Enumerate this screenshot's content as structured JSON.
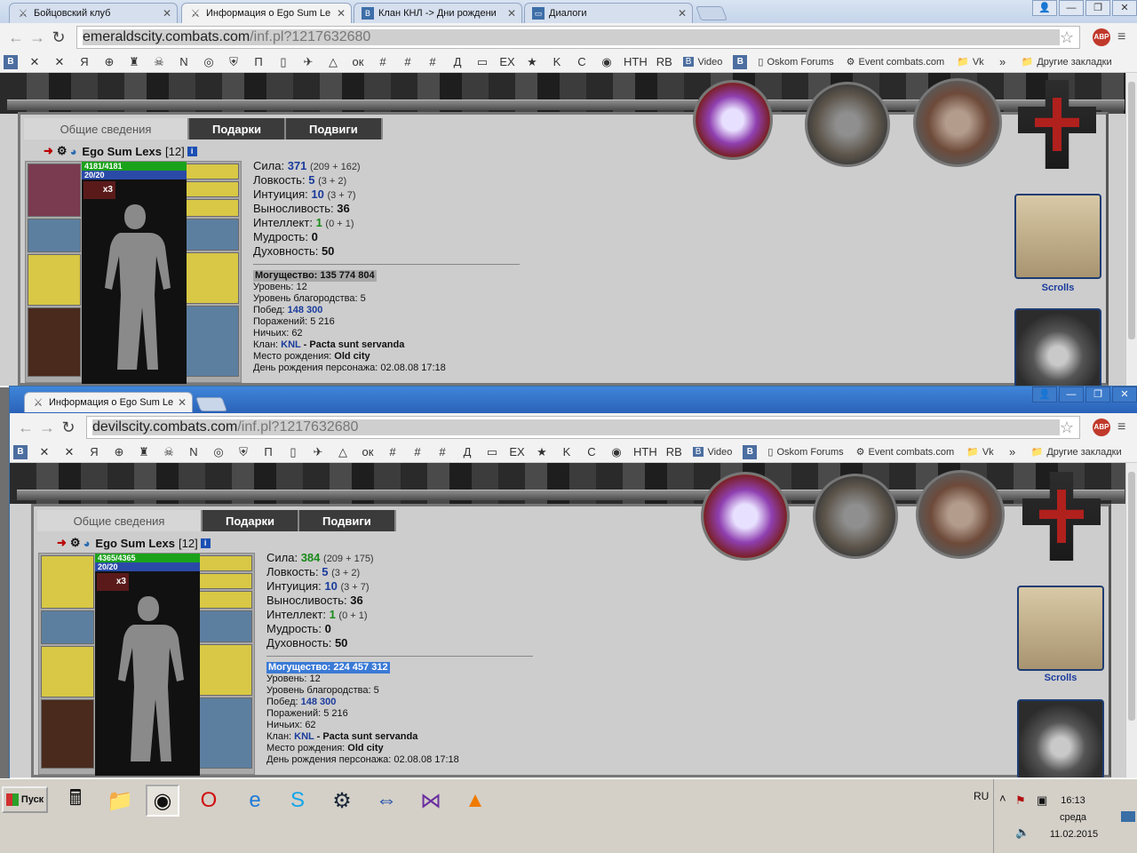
{
  "win1": {
    "tabs": [
      {
        "label": "Бойцовский клуб",
        "icon": "crossed-swords-icon"
      },
      {
        "label": "Информация о Ego Sum Lexs",
        "icon": "crossed-swords-icon",
        "active": true
      },
      {
        "label": "Клан КНЛ -> Дни рождени",
        "icon": "vk-icon"
      },
      {
        "label": "Диалоги",
        "icon": "chat-icon"
      }
    ],
    "url_host": "emeraldscity.combats.com",
    "url_path": "/inf.pl?1217632680",
    "char": {
      "nick": "Ego Sum Lexs",
      "level": "[12]",
      "hp": "4181/4181",
      "mp": "20/20",
      "effect": "x3",
      "stats": [
        {
          "label": "Сила:",
          "value": "371",
          "extra": "(209 + 162)",
          "style": "blue"
        },
        {
          "label": "Ловкость:",
          "value": "5",
          "extra": "(3 + 2)",
          "style": "blue"
        },
        {
          "label": "Интуиция:",
          "value": "10",
          "extra": "(3 + 7)",
          "style": "blue"
        },
        {
          "label": "Выносливость:",
          "value": "36",
          "extra": "",
          "style": "plain"
        },
        {
          "label": "Интеллект:",
          "value": "1",
          "extra": "(0 + 1)",
          "style": "green"
        },
        {
          "label": "Мудрость:",
          "value": "0",
          "extra": "",
          "style": "plain"
        },
        {
          "label": "Духовность:",
          "value": "50",
          "extra": "",
          "style": "plain"
        }
      ],
      "power_label": "Могущество: 135 774 804",
      "info": [
        {
          "label": "Уровень: ",
          "value": "12"
        },
        {
          "label": "Уровень благородства: ",
          "value": "5"
        },
        {
          "label": "Побед: ",
          "value": "148 300",
          "blue": true
        },
        {
          "label": "Поражений: ",
          "value": "5 216"
        },
        {
          "label": "Ничьих: ",
          "value": "62"
        },
        {
          "label": "Клан: ",
          "value": "KNL",
          "blue": true,
          "suffix": " - Pacta sunt servanda"
        },
        {
          "label": "Место рождения: ",
          "value": "Old city",
          "bold": true
        },
        {
          "label": "День рождения персонажа: ",
          "value": "02.08.08 17:18"
        }
      ]
    }
  },
  "win2": {
    "tab": {
      "label": "Информация о Ego Sum Lex",
      "icon": "crossed-swords-icon"
    },
    "url_host": "devilscity.combats.com",
    "url_path": "/inf.pl?1217632680",
    "char": {
      "nick": "Ego Sum Lexs",
      "level": "[12]",
      "hp": "4365/4365",
      "mp": "20/20",
      "effect": "x3",
      "stats": [
        {
          "label": "Сила:",
          "value": "384",
          "extra": "(209 + 175)",
          "style": "green"
        },
        {
          "label": "Ловкость:",
          "value": "5",
          "extra": "(3 + 2)",
          "style": "blue"
        },
        {
          "label": "Интуиция:",
          "value": "10",
          "extra": "(3 + 7)",
          "style": "blue"
        },
        {
          "label": "Выносливость:",
          "value": "36",
          "extra": "",
          "style": "plain"
        },
        {
          "label": "Интеллект:",
          "value": "1",
          "extra": "(0 + 1)",
          "style": "green"
        },
        {
          "label": "Мудрость:",
          "value": "0",
          "extra": "",
          "style": "plain"
        },
        {
          "label": "Духовность:",
          "value": "50",
          "extra": "",
          "style": "plain"
        }
      ],
      "power_label": "Могущество: 224 457 312",
      "info": [
        {
          "label": "Уровень: ",
          "value": "12"
        },
        {
          "label": "Уровень благородства: ",
          "value": "5"
        },
        {
          "label": "Побед: ",
          "value": "148 300",
          "blue": true
        },
        {
          "label": "Поражений: ",
          "value": "5 216"
        },
        {
          "label": "Ничьих: ",
          "value": "62"
        },
        {
          "label": "Клан: ",
          "value": "KNL",
          "blue": true,
          "suffix": " - Pacta sunt servanda"
        },
        {
          "label": "Место рождения: ",
          "value": "Old city",
          "bold": true
        },
        {
          "label": "День рождения персонажа: ",
          "value": "02.08.08 17:18"
        }
      ]
    }
  },
  "info_tabs": [
    "Общие сведения",
    "Подарки",
    "Подвиги"
  ],
  "bookmarks": {
    "icons": [
      "vk-icon",
      "swords-icon",
      "swords-icon",
      "yandex-icon",
      "target-icon",
      "castle-icon",
      "skull-icon",
      "n-icon",
      "globe-icon",
      "shield-icon",
      "p-icon",
      "page-icon",
      "bird-icon",
      "triangle-icon",
      "ok-icon",
      "hash-icon",
      "hash-icon",
      "hash-icon",
      "dynamo-icon",
      "tv-icon",
      "ex-icon",
      "star-icon",
      "k-icon",
      "c-icon",
      "eye-icon",
      "ntn-icon",
      "rb-icon"
    ],
    "video": "Video",
    "oskom": "Oskom Forums",
    "event": "Event combats.com",
    "vk": "Vk",
    "more": "»",
    "other": "Другие закладки"
  },
  "side": {
    "scrolls_label": "Scrolls"
  },
  "taskbar": {
    "start": "Пуск",
    "lang": "RU",
    "time": "16:13",
    "day": "среда",
    "date": "11.02.2015",
    "apps": [
      "calculator-icon",
      "folder-icon",
      "chrome-icon",
      "opera-icon",
      "ie-icon",
      "skype-icon",
      "steam-icon",
      "teamviewer-icon",
      "vs-icon",
      "vlc-icon"
    ]
  },
  "colors": {
    "accent": "#3a7ad6",
    "hp": "#1aa21a",
    "mp": "#2a4aa8",
    "link": "#1a3b9c"
  }
}
